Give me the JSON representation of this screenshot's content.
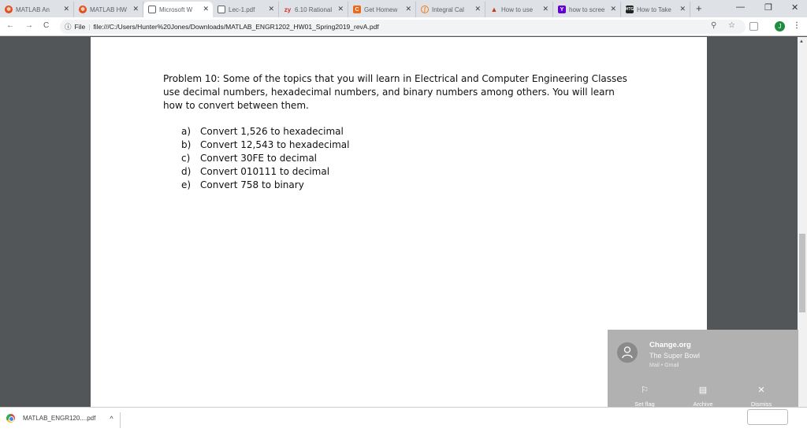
{
  "tabs": [
    {
      "label": "MATLAB An",
      "icon": "matlab-icon",
      "color": "#e04f1a"
    },
    {
      "label": "MATLAB HW",
      "icon": "matlab-icon",
      "color": "#e04f1a"
    },
    {
      "label": "Microsoft W",
      "icon": "document-icon",
      "color": "#5f6368",
      "active": true
    },
    {
      "label": "Lec-1.pdf",
      "icon": "document-icon",
      "color": "#5f6368"
    },
    {
      "label": "6.10 Rational",
      "icon": "zybooks-icon",
      "color": "#d93025"
    },
    {
      "label": "Get Homew",
      "icon": "chegg-icon",
      "color": "#ea6a1a"
    },
    {
      "label": "Integral Cal",
      "icon": "wolfram-icon",
      "color": "#f07d1e"
    },
    {
      "label": "How to use",
      "icon": "matlab-peak-icon",
      "color": "#0076a8"
    },
    {
      "label": "how to scree",
      "icon": "yahoo-icon",
      "color": "#6001d2"
    },
    {
      "label": "How to Take",
      "icon": "howtogeek-icon",
      "color": "#222222"
    }
  ],
  "new_tab": "+",
  "window": {
    "minimize": "—",
    "maximize": "❐",
    "close": "✕"
  },
  "nav": {
    "back": "←",
    "forward": "→",
    "reload": "C"
  },
  "omnibox": {
    "info": "ⓘ",
    "scheme_label": "File",
    "url": "file:///C:/Users/Hunter%20Jones/Downloads/MATLAB_ENGR1202_HW01_Spring2019_revA.pdf"
  },
  "toolbar_right": {
    "zoom": "⚲",
    "star": "☆",
    "avatar": "J",
    "menu": "⋮"
  },
  "document": {
    "problem": "Problem 10: Some of the topics that you will learn in Electrical and Computer Engineering Classes use decimal numbers, hexadecimal numbers, and binary numbers among others. You will learn how to convert between them.",
    "items": [
      {
        "letter": "a)",
        "text": "Convert 1,526 to hexadecimal"
      },
      {
        "letter": "b)",
        "text": "Convert 12,543 to hexadecimal"
      },
      {
        "letter": "c)",
        "text": "Convert 30FE to decimal"
      },
      {
        "letter": "d)",
        "text": "Convert 010111 to decimal"
      },
      {
        "letter": "e)",
        "text": "Convert 758 to binary"
      }
    ]
  },
  "toast": {
    "title": "Change.org",
    "subtitle": "The Super Bowl",
    "source": "Mail • Gmail",
    "actions": [
      {
        "label": "Set flag",
        "icon": "flag-icon"
      },
      {
        "label": "Archive",
        "icon": "archive-icon"
      },
      {
        "label": "Dismiss",
        "icon": "close-icon"
      }
    ]
  },
  "download": {
    "filename": "MATLAB_ENGR120....pdf",
    "caret": "^"
  }
}
